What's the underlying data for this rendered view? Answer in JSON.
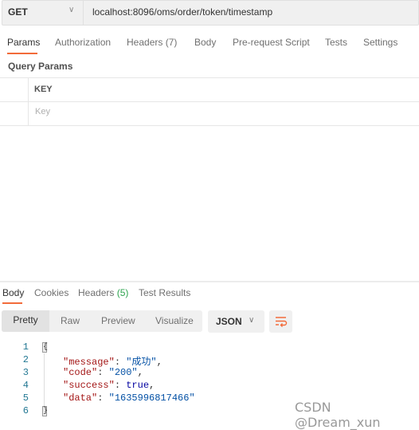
{
  "request": {
    "method": "GET",
    "url": "localhost:8096/oms/order/token/timestamp"
  },
  "request_tabs": [
    "Params",
    "Authorization",
    "Headers (7)",
    "Body",
    "Pre-request Script",
    "Tests",
    "Settings"
  ],
  "query_params": {
    "title": "Query Params",
    "column": "KEY",
    "placeholder": "Key"
  },
  "response_tabs": {
    "body": "Body",
    "cookies": "Cookies",
    "headers": "Headers",
    "headers_count": "(5)",
    "tests": "Test Results"
  },
  "view_modes": [
    "Pretty",
    "Raw",
    "Preview",
    "Visualize"
  ],
  "format": "JSON",
  "code": {
    "line_numbers": [
      "1",
      "2",
      "3",
      "4",
      "5",
      "6"
    ],
    "open": "{",
    "close": "}",
    "lines": [
      {
        "key": "\"message\"",
        "value": "\"成功\"",
        "comma": ","
      },
      {
        "key": "\"code\"",
        "value": "\"200\"",
        "comma": ","
      },
      {
        "key": "\"success\"",
        "value": "true",
        "comma": ","
      },
      {
        "key": "\"data\"",
        "value": "\"1635996817466\"",
        "comma": ""
      }
    ]
  },
  "watermark": "CSDN @Dream_xun",
  "colors": {
    "accent": "#f26b3a",
    "key": "#a31515",
    "string": "#0451a5",
    "line_number": "#237893"
  }
}
